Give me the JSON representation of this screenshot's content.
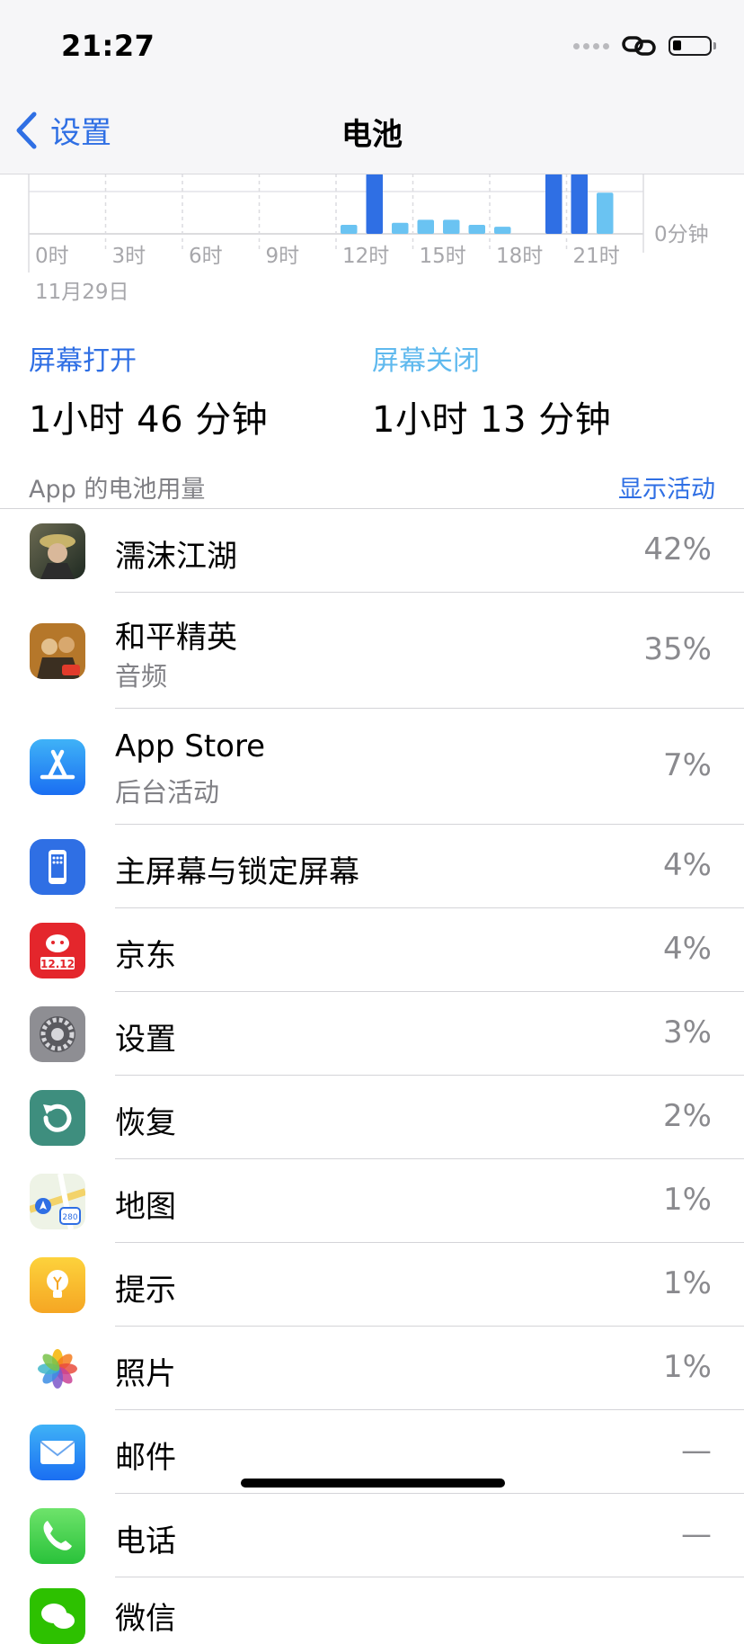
{
  "status_bar": {
    "time": "21:27"
  },
  "nav": {
    "back_label": "设置",
    "title": "电池"
  },
  "chart_data": {
    "type": "bar",
    "categories": [
      "0时",
      "1",
      "2",
      "3时",
      "4",
      "5",
      "6时",
      "7",
      "8",
      "9时",
      "10",
      "11",
      "12时",
      "13",
      "14",
      "15时",
      "16",
      "17",
      "18时",
      "19",
      "20",
      "21时",
      "22",
      "23"
    ],
    "x_tick_labels": [
      "0时",
      "3时",
      "6时",
      "9时",
      "12时",
      "15时",
      "18时",
      "21时"
    ],
    "date_label": "11月29日",
    "y_tick_label": "0分钟",
    "series": [
      {
        "name": "屏幕打开",
        "color": "#2f6fe4",
        "values": [
          0,
          0,
          0,
          0,
          0,
          0,
          0,
          0,
          0,
          0,
          0,
          0,
          0,
          60,
          0,
          0,
          0,
          0,
          0,
          0,
          60,
          60,
          0,
          0
        ]
      },
      {
        "name": "屏幕关闭",
        "color": "#6ac3f2",
        "values": [
          0,
          0,
          0,
          0,
          0,
          0,
          0,
          0,
          0,
          0,
          0,
          0,
          9,
          0,
          11,
          14,
          14,
          9,
          7,
          0,
          0,
          0,
          41,
          0
        ]
      }
    ]
  },
  "screen_on": {
    "label": "屏幕打开",
    "value": "1小时 46 分钟"
  },
  "screen_off": {
    "label": "屏幕关闭",
    "value": "1小时 13 分钟"
  },
  "usage_section": {
    "title": "App 的电池用量",
    "action": "显示活动"
  },
  "apps": [
    {
      "name": "濡沫江湖",
      "sub": "",
      "percent": "42%",
      "icon": "game-icon"
    },
    {
      "name": "和平精英",
      "sub": "音频",
      "percent": "35%",
      "icon": "game-pubg-icon"
    },
    {
      "name": "App Store",
      "sub": "后台活动",
      "percent": "7%",
      "icon": "app-store-icon"
    },
    {
      "name": "主屏幕与锁定屏幕",
      "sub": "",
      "percent": "4%",
      "icon": "phone-screen-icon"
    },
    {
      "name": "京东",
      "sub": "",
      "percent": "4%",
      "icon": "jd-icon"
    },
    {
      "name": "设置",
      "sub": "",
      "percent": "3%",
      "icon": "settings-gear-icon"
    },
    {
      "name": "恢复",
      "sub": "",
      "percent": "2%",
      "icon": "restore-icon"
    },
    {
      "name": "地图",
      "sub": "",
      "percent": "1%",
      "icon": "maps-icon"
    },
    {
      "name": "提示",
      "sub": "",
      "percent": "1%",
      "icon": "tips-bulb-icon"
    },
    {
      "name": "照片",
      "sub": "",
      "percent": "1%",
      "icon": "photos-icon"
    },
    {
      "name": "邮件",
      "sub": "",
      "percent": "—",
      "icon": "mail-icon"
    },
    {
      "name": "电话",
      "sub": "",
      "percent": "—",
      "icon": "phone-icon"
    },
    {
      "name": "微信",
      "sub": "",
      "percent": "",
      "icon": "wechat-icon"
    }
  ]
}
